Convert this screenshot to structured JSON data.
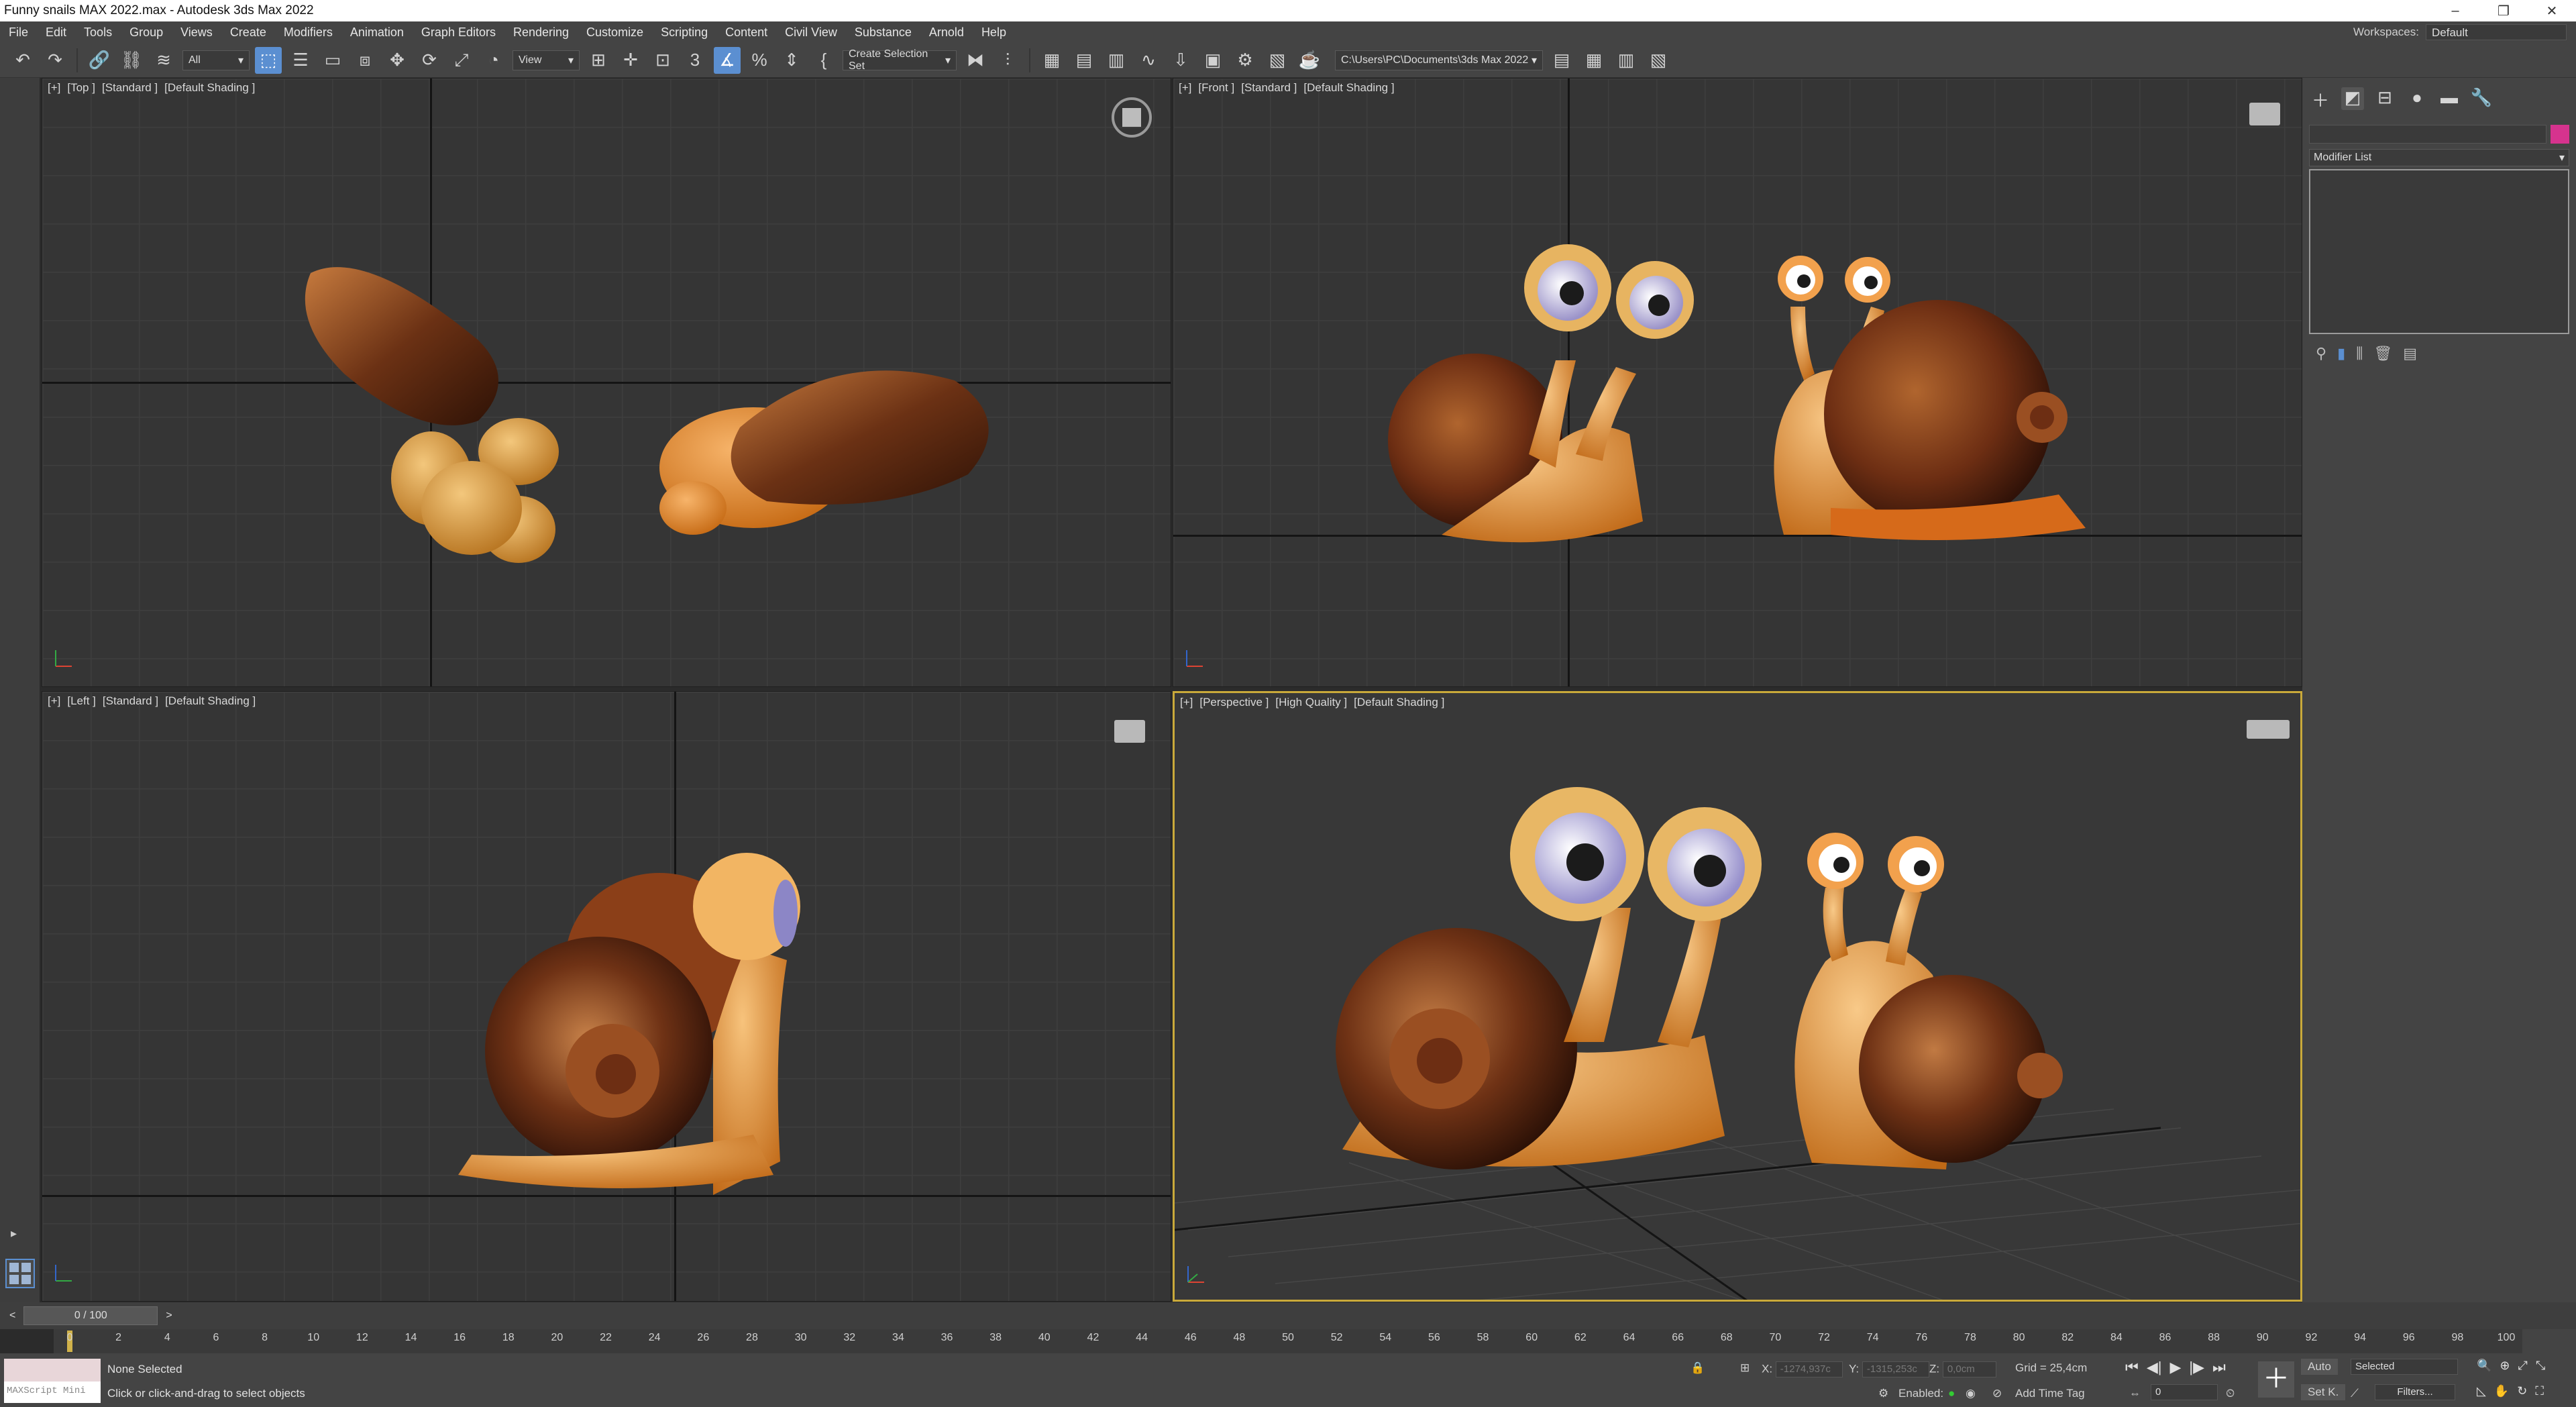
{
  "window": {
    "title": "Funny snails MAX 2022.max - Autodesk 3ds Max 2022",
    "controls": [
      "–",
      "❐",
      "✕"
    ]
  },
  "menu": {
    "items": [
      "File",
      "Edit",
      "Tools",
      "Group",
      "Views",
      "Create",
      "Modifiers",
      "Animation",
      "Graph Editors",
      "Rendering",
      "Customize",
      "Scripting",
      "Content",
      "Civil View",
      "Substance",
      "Arnold",
      "Help"
    ],
    "workspaces_label": "Workspaces:",
    "workspace_value": "Default"
  },
  "toolbar": {
    "filter_value": "All",
    "refcoord_value": "View",
    "selection_set_value": "Create Selection Set",
    "project_path": "C:\\Users\\PC\\Documents\\3ds Max 2022"
  },
  "viewports": {
    "top": {
      "plus": "[+]",
      "view": "[Top ]",
      "mode": "[Standard ]",
      "shading": "[Default Shading ]"
    },
    "front": {
      "plus": "[+]",
      "view": "[Front ]",
      "mode": "[Standard ]",
      "shading": "[Default Shading ]"
    },
    "left": {
      "plus": "[+]",
      "view": "[Left ]",
      "mode": "[Standard ]",
      "shading": "[Default Shading ]"
    },
    "perspective": {
      "plus": "[+]",
      "view": "[Perspective ]",
      "mode": "[High Quality ]",
      "shading": "[Default Shading ]"
    }
  },
  "command_panel": {
    "modifier_list": "Modifier List",
    "accent_color": "#d6338e"
  },
  "timeline": {
    "slider_value": "0 / 100",
    "ticks": [
      "0",
      "2",
      "4",
      "6",
      "8",
      "10",
      "12",
      "14",
      "16",
      "18",
      "20",
      "22",
      "24",
      "26",
      "28",
      "30",
      "32",
      "34",
      "36",
      "38",
      "40",
      "42",
      "44",
      "46",
      "48",
      "50",
      "52",
      "54",
      "56",
      "58",
      "60",
      "62",
      "64",
      "66",
      "68",
      "70",
      "72",
      "74",
      "76",
      "78",
      "80",
      "82",
      "84",
      "86",
      "88",
      "90",
      "92",
      "94",
      "96",
      "98",
      "100"
    ]
  },
  "status": {
    "maxscript": "MAXScript Mini",
    "selection": "None Selected",
    "prompt": "Click or click-and-drag to select objects",
    "x_label": "X:",
    "x_value": "-1274,937c",
    "y_label": "Y:",
    "y_value": "-1315,253c",
    "z_label": "Z:",
    "z_value": "0,0cm",
    "grid": "Grid = 25,4cm",
    "enabled": "Enabled:",
    "add_time_tag": "Add Time Tag",
    "auto": "Auto",
    "selected": "Selected",
    "set_key": "Set K.",
    "filters": "Filters...",
    "frame": "0"
  }
}
